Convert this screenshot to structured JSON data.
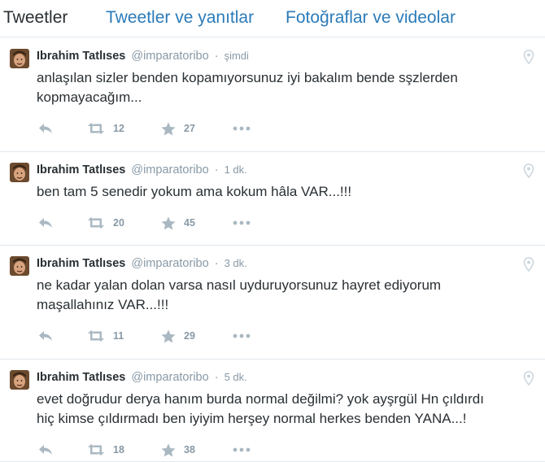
{
  "tabs": [
    {
      "label": "Tweetler",
      "active": true
    },
    {
      "label": "Tweetler ve yanıtlar",
      "active": false
    },
    {
      "label": "Fotoğraflar ve videolar",
      "active": false
    }
  ],
  "colors": {
    "link": "#2b7bb9",
    "text": "#292f33",
    "muted": "#8899a6",
    "icon": "#aab8c2",
    "border": "#e1e8ed"
  },
  "tweets": [
    {
      "fullname": "Ibrahim Tatlıses",
      "username": "@imparatoribo",
      "separator": "·",
      "time": "şimdi",
      "text_lines": [
        "anlaşılan sizler benden kopamıyorsunuz iyi bakalım bende sşzlerden",
        "kopmayacağım..."
      ],
      "retweets": "12",
      "favorites": "27"
    },
    {
      "fullname": "Ibrahim Tatlıses",
      "username": "@imparatoribo",
      "separator": "·",
      "time": "1 dk.",
      "text_lines": [
        "ben tam 5 senedir yokum ama kokum hâla VAR...!!!"
      ],
      "retweets": "20",
      "favorites": "45"
    },
    {
      "fullname": "Ibrahim Tatlıses",
      "username": "@imparatoribo",
      "separator": "·",
      "time": "3 dk.",
      "text_lines": [
        "ne kadar yalan dolan varsa nasıl uyduruyorsunuz hayret ediyorum",
        "maşallahınız VAR...!!!"
      ],
      "retweets": "11",
      "favorites": "29"
    },
    {
      "fullname": "Ibrahim Tatlıses",
      "username": "@imparatoribo",
      "separator": "·",
      "time": "5 dk.",
      "text_lines": [
        "evet doğrudur derya hanım burda normal değilmi? yok ayşrgül Hn çıldırdı",
        "hiç kimse çıldırmadı ben iyiyim herşey normal herkes benden YANA...!"
      ],
      "retweets": "18",
      "favorites": "38"
    }
  ]
}
